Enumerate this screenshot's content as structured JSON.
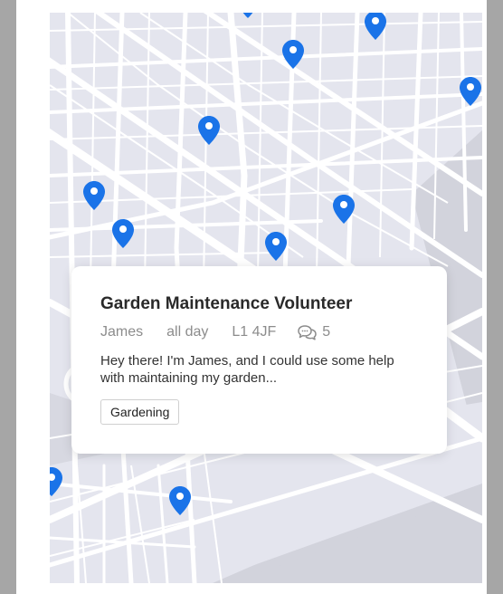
{
  "colors": {
    "pin": "#1a73e8",
    "map_background": "#e4e5ee",
    "road": "#ffffff",
    "water": "#d2d3dc"
  },
  "card": {
    "title": "Garden Maintenance Volunteer",
    "author": "James",
    "time": "all day",
    "location": "L1 4JF",
    "comment_count": "5",
    "comment_icon": "chat-bubbles-icon",
    "description": "Hey there! I'm James, and I could use some help with maintaining my garden...",
    "tag": "Gardening"
  }
}
